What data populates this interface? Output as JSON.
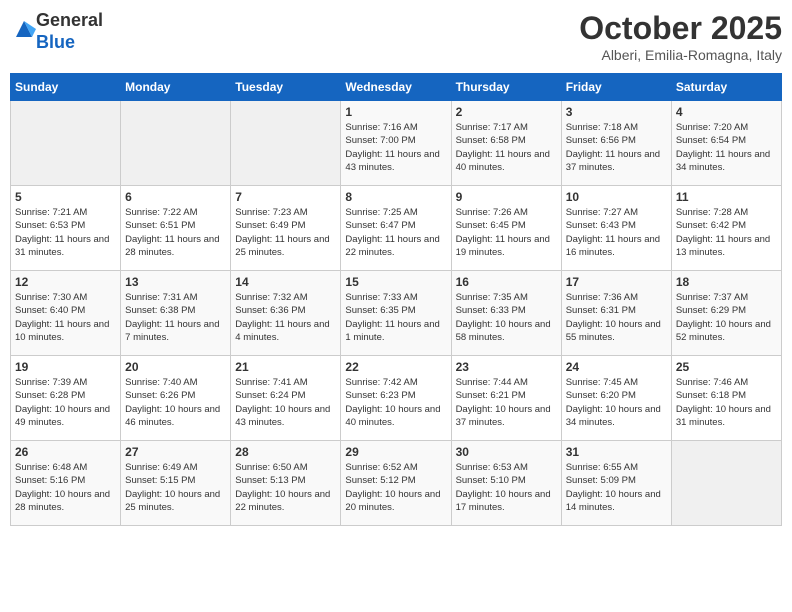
{
  "header": {
    "logo_general": "General",
    "logo_blue": "Blue",
    "month": "October 2025",
    "location": "Alberi, Emilia-Romagna, Italy"
  },
  "days_of_week": [
    "Sunday",
    "Monday",
    "Tuesday",
    "Wednesday",
    "Thursday",
    "Friday",
    "Saturday"
  ],
  "weeks": [
    [
      {
        "day": null,
        "sunrise": null,
        "sunset": null,
        "daylight": null
      },
      {
        "day": null,
        "sunrise": null,
        "sunset": null,
        "daylight": null
      },
      {
        "day": null,
        "sunrise": null,
        "sunset": null,
        "daylight": null
      },
      {
        "day": "1",
        "sunrise": "Sunrise: 7:16 AM",
        "sunset": "Sunset: 7:00 PM",
        "daylight": "Daylight: 11 hours and 43 minutes."
      },
      {
        "day": "2",
        "sunrise": "Sunrise: 7:17 AM",
        "sunset": "Sunset: 6:58 PM",
        "daylight": "Daylight: 11 hours and 40 minutes."
      },
      {
        "day": "3",
        "sunrise": "Sunrise: 7:18 AM",
        "sunset": "Sunset: 6:56 PM",
        "daylight": "Daylight: 11 hours and 37 minutes."
      },
      {
        "day": "4",
        "sunrise": "Sunrise: 7:20 AM",
        "sunset": "Sunset: 6:54 PM",
        "daylight": "Daylight: 11 hours and 34 minutes."
      }
    ],
    [
      {
        "day": "5",
        "sunrise": "Sunrise: 7:21 AM",
        "sunset": "Sunset: 6:53 PM",
        "daylight": "Daylight: 11 hours and 31 minutes."
      },
      {
        "day": "6",
        "sunrise": "Sunrise: 7:22 AM",
        "sunset": "Sunset: 6:51 PM",
        "daylight": "Daylight: 11 hours and 28 minutes."
      },
      {
        "day": "7",
        "sunrise": "Sunrise: 7:23 AM",
        "sunset": "Sunset: 6:49 PM",
        "daylight": "Daylight: 11 hours and 25 minutes."
      },
      {
        "day": "8",
        "sunrise": "Sunrise: 7:25 AM",
        "sunset": "Sunset: 6:47 PM",
        "daylight": "Daylight: 11 hours and 22 minutes."
      },
      {
        "day": "9",
        "sunrise": "Sunrise: 7:26 AM",
        "sunset": "Sunset: 6:45 PM",
        "daylight": "Daylight: 11 hours and 19 minutes."
      },
      {
        "day": "10",
        "sunrise": "Sunrise: 7:27 AM",
        "sunset": "Sunset: 6:43 PM",
        "daylight": "Daylight: 11 hours and 16 minutes."
      },
      {
        "day": "11",
        "sunrise": "Sunrise: 7:28 AM",
        "sunset": "Sunset: 6:42 PM",
        "daylight": "Daylight: 11 hours and 13 minutes."
      }
    ],
    [
      {
        "day": "12",
        "sunrise": "Sunrise: 7:30 AM",
        "sunset": "Sunset: 6:40 PM",
        "daylight": "Daylight: 11 hours and 10 minutes."
      },
      {
        "day": "13",
        "sunrise": "Sunrise: 7:31 AM",
        "sunset": "Sunset: 6:38 PM",
        "daylight": "Daylight: 11 hours and 7 minutes."
      },
      {
        "day": "14",
        "sunrise": "Sunrise: 7:32 AM",
        "sunset": "Sunset: 6:36 PM",
        "daylight": "Daylight: 11 hours and 4 minutes."
      },
      {
        "day": "15",
        "sunrise": "Sunrise: 7:33 AM",
        "sunset": "Sunset: 6:35 PM",
        "daylight": "Daylight: 11 hours and 1 minute."
      },
      {
        "day": "16",
        "sunrise": "Sunrise: 7:35 AM",
        "sunset": "Sunset: 6:33 PM",
        "daylight": "Daylight: 10 hours and 58 minutes."
      },
      {
        "day": "17",
        "sunrise": "Sunrise: 7:36 AM",
        "sunset": "Sunset: 6:31 PM",
        "daylight": "Daylight: 10 hours and 55 minutes."
      },
      {
        "day": "18",
        "sunrise": "Sunrise: 7:37 AM",
        "sunset": "Sunset: 6:29 PM",
        "daylight": "Daylight: 10 hours and 52 minutes."
      }
    ],
    [
      {
        "day": "19",
        "sunrise": "Sunrise: 7:39 AM",
        "sunset": "Sunset: 6:28 PM",
        "daylight": "Daylight: 10 hours and 49 minutes."
      },
      {
        "day": "20",
        "sunrise": "Sunrise: 7:40 AM",
        "sunset": "Sunset: 6:26 PM",
        "daylight": "Daylight: 10 hours and 46 minutes."
      },
      {
        "day": "21",
        "sunrise": "Sunrise: 7:41 AM",
        "sunset": "Sunset: 6:24 PM",
        "daylight": "Daylight: 10 hours and 43 minutes."
      },
      {
        "day": "22",
        "sunrise": "Sunrise: 7:42 AM",
        "sunset": "Sunset: 6:23 PM",
        "daylight": "Daylight: 10 hours and 40 minutes."
      },
      {
        "day": "23",
        "sunrise": "Sunrise: 7:44 AM",
        "sunset": "Sunset: 6:21 PM",
        "daylight": "Daylight: 10 hours and 37 minutes."
      },
      {
        "day": "24",
        "sunrise": "Sunrise: 7:45 AM",
        "sunset": "Sunset: 6:20 PM",
        "daylight": "Daylight: 10 hours and 34 minutes."
      },
      {
        "day": "25",
        "sunrise": "Sunrise: 7:46 AM",
        "sunset": "Sunset: 6:18 PM",
        "daylight": "Daylight: 10 hours and 31 minutes."
      }
    ],
    [
      {
        "day": "26",
        "sunrise": "Sunrise: 6:48 AM",
        "sunset": "Sunset: 5:16 PM",
        "daylight": "Daylight: 10 hours and 28 minutes."
      },
      {
        "day": "27",
        "sunrise": "Sunrise: 6:49 AM",
        "sunset": "Sunset: 5:15 PM",
        "daylight": "Daylight: 10 hours and 25 minutes."
      },
      {
        "day": "28",
        "sunrise": "Sunrise: 6:50 AM",
        "sunset": "Sunset: 5:13 PM",
        "daylight": "Daylight: 10 hours and 22 minutes."
      },
      {
        "day": "29",
        "sunrise": "Sunrise: 6:52 AM",
        "sunset": "Sunset: 5:12 PM",
        "daylight": "Daylight: 10 hours and 20 minutes."
      },
      {
        "day": "30",
        "sunrise": "Sunrise: 6:53 AM",
        "sunset": "Sunset: 5:10 PM",
        "daylight": "Daylight: 10 hours and 17 minutes."
      },
      {
        "day": "31",
        "sunrise": "Sunrise: 6:55 AM",
        "sunset": "Sunset: 5:09 PM",
        "daylight": "Daylight: 10 hours and 14 minutes."
      },
      {
        "day": null,
        "sunrise": null,
        "sunset": null,
        "daylight": null
      }
    ]
  ]
}
